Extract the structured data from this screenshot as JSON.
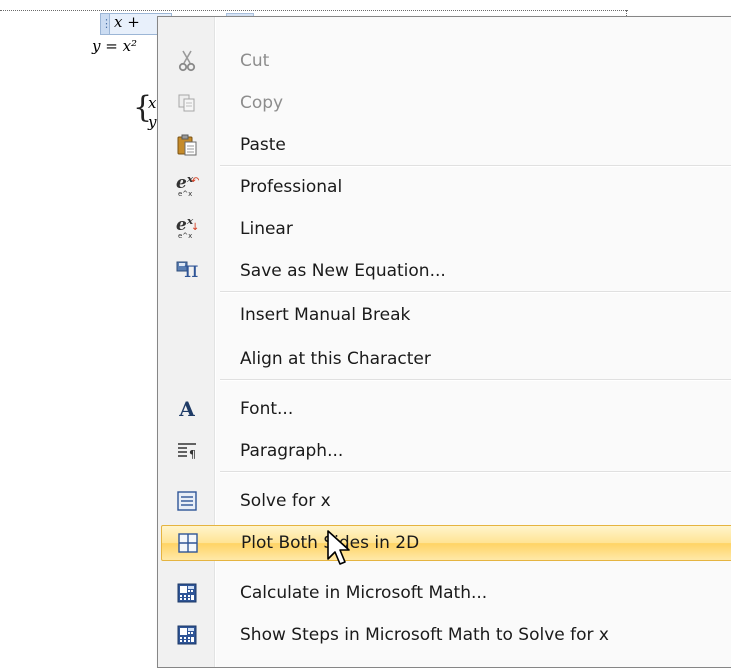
{
  "document": {
    "eq_line1": "x +",
    "eq_line2": "y = x²",
    "sys_x": "x",
    "sys_y": "y",
    "brace": "{"
  },
  "menu": {
    "items": [
      {
        "label": "Cut",
        "icon": "scissors-icon",
        "enabled": false
      },
      {
        "label": "Copy",
        "icon": "copy-icon",
        "enabled": false
      },
      {
        "label": "Paste",
        "icon": "paste-icon",
        "enabled": true
      },
      {
        "label": "Professional",
        "icon": "professional-format-icon",
        "enabled": true
      },
      {
        "label": "Linear",
        "icon": "linear-format-icon",
        "enabled": true
      },
      {
        "label": "Save as New Equation...",
        "icon": "save-equation-icon",
        "enabled": true
      },
      {
        "label": "Insert Manual Break",
        "icon": "",
        "enabled": true
      },
      {
        "label": "Align at this Character",
        "icon": "",
        "enabled": true
      },
      {
        "label": "Font...",
        "icon": "font-icon",
        "enabled": true
      },
      {
        "label": "Paragraph...",
        "icon": "paragraph-icon",
        "enabled": true
      },
      {
        "label": "Solve for x",
        "icon": "solve-icon",
        "enabled": true
      },
      {
        "label": "Plot Both Sides in 2D",
        "icon": "plot-2d-icon",
        "enabled": true,
        "highlighted": true
      },
      {
        "label": "Calculate in Microsoft Math...",
        "icon": "microsoft-math-icon",
        "enabled": true
      },
      {
        "label": "Show Steps in Microsoft Math to Solve for x",
        "icon": "microsoft-math-steps-icon",
        "enabled": true
      }
    ],
    "icon_glyphs": {
      "professional": "eˣ",
      "professional_sub": "e^x",
      "linear": "eˣ",
      "pi": "π",
      "font": "A"
    }
  },
  "colors": {
    "highlight_border": "#e5b440",
    "highlight_fill": "#ffe494",
    "disabled_text": "#8d8d8d"
  }
}
